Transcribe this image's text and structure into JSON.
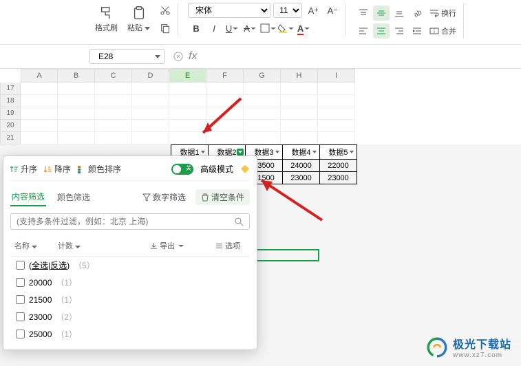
{
  "ribbon": {
    "format_painter": "格式刷",
    "paste": "粘贴",
    "font_name": "宋体",
    "font_size": "11",
    "wrap": "换行",
    "merge": "合并"
  },
  "namebox": {
    "cell": "E28",
    "fx": "fx"
  },
  "columns": [
    "A",
    "B",
    "C",
    "D",
    "E",
    "F",
    "G",
    "H",
    "I"
  ],
  "selected_col": "E",
  "rows": [
    "17",
    "18",
    "19",
    "20",
    "21"
  ],
  "table": {
    "headers": [
      "数据1",
      "数据2",
      "数据3",
      "数据4",
      "数据5"
    ],
    "rows": [
      [
        "23500",
        "24000",
        "22000"
      ],
      [
        "21500",
        "23000",
        "23000"
      ]
    ]
  },
  "filter": {
    "asc": "升序",
    "desc": "降序",
    "color_sort": "颜色排序",
    "adv_toggle_off": "关",
    "adv_mode": "高级模式",
    "tab_content": "内容筛选",
    "tab_color": "颜色筛选",
    "num_filter": "数字筛选",
    "clear": "清空条件",
    "search_ph": "(支持多条件过滤，例如：北京 上海)",
    "col_name": "名称",
    "col_count": "计数",
    "export": "导出",
    "options": "选项",
    "select_all": "全选",
    "invert": "反选",
    "total": "（5）",
    "items": [
      {
        "v": "20000",
        "c": "（1）"
      },
      {
        "v": "21500",
        "c": "（1）"
      },
      {
        "v": "23000",
        "c": "（2）"
      },
      {
        "v": "25000",
        "c": "（1）"
      }
    ]
  },
  "watermark": {
    "name": "极光下载站",
    "url": "www.xz7.com"
  }
}
